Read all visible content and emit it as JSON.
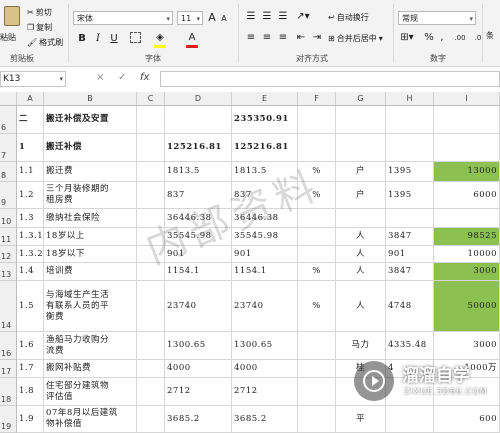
{
  "ribbon": {
    "clipboard": {
      "paste": "粘贴",
      "cut": "剪切",
      "copy": "复制",
      "format_painter": "格式刷",
      "group": "剪贴板"
    },
    "font": {
      "name": "宋体",
      "size": "11",
      "grow": "A",
      "shrink": "A",
      "bold": "B",
      "italic": "I",
      "underline": "U",
      "group": "字体"
    },
    "alignment": {
      "wrap": "自动换行",
      "merge": "合并后居中",
      "group": "对齐方式"
    },
    "number": {
      "format": "常规",
      "percent": "%",
      "comma": ",",
      "group": "数字",
      "extra": "条"
    }
  },
  "formula_bar": {
    "name_box": "K13",
    "cancel": "×",
    "enter": "✓",
    "fx": "fx",
    "value": ""
  },
  "columns": [
    "A",
    "B",
    "C",
    "D",
    "E",
    "F",
    "G",
    "H",
    "I"
  ],
  "rows": [
    {
      "n": "6",
      "a": "二",
      "b": "搬迁补偿及安置",
      "c": "",
      "d": "",
      "e": "235350.91",
      "f": "",
      "g": "",
      "h": "",
      "i": ""
    },
    {
      "n": "7",
      "a": "1",
      "b": "搬迁补偿",
      "c": "",
      "d": "125216.81",
      "e": "125216.81",
      "f": "",
      "g": "",
      "h": "",
      "i": ""
    },
    {
      "n": "8",
      "a": "1.1",
      "b": "搬迁费",
      "c": "",
      "d": "1813.5",
      "e": "1813.5",
      "f": "%",
      "g": "户",
      "h": "1395",
      "i": "13000"
    },
    {
      "n": "9",
      "a": "1.2",
      "b": "三个月装修期的\n租房费",
      "c": "",
      "d": "837",
      "e": "837",
      "f": "%",
      "g": "户",
      "h": "1395",
      "i": "6000"
    },
    {
      "n": "10",
      "a": "1.3",
      "b": "缴纳社会保险",
      "c": "",
      "d": "36446.38",
      "e": "36446.38",
      "f": "",
      "g": "",
      "h": "",
      "i": ""
    },
    {
      "n": "11",
      "a": "1.3.1",
      "b": "18岁以上",
      "c": "",
      "d": "35545.98",
      "e": "35545.98",
      "f": "",
      "g": "人",
      "h": "3847",
      "i": "98525"
    },
    {
      "n": "12",
      "a": "1.3.2",
      "b": "18岁以下",
      "c": "",
      "d": "901",
      "e": "901",
      "f": "",
      "g": "人",
      "h": "901",
      "i": "10000"
    },
    {
      "n": "13",
      "a": "1.4",
      "b": "培训费",
      "c": "",
      "d": "1154.1",
      "e": "1154.1",
      "f": "%",
      "g": "人",
      "h": "3847",
      "i": "3000"
    },
    {
      "n": "14",
      "a": "1.5",
      "b": "与海域生产生活\n有联系人员的平\n衡费",
      "c": "",
      "d": "23740",
      "e": "23740",
      "f": "%",
      "g": "人",
      "h": "4748",
      "i": "50000"
    },
    {
      "n": "16",
      "a": "1.6",
      "b": "渔船马力收购分\n流费",
      "c": "",
      "d": "1300.65",
      "e": "1300.65",
      "f": "",
      "g": "马力",
      "h": "4335.48",
      "i": "3000"
    },
    {
      "n": "17",
      "a": "1.7",
      "b": "搬网补贴费",
      "c": "",
      "d": "4000",
      "e": "4000",
      "f": "",
      "g": "桂",
      "h": "4",
      "i": "1000万"
    },
    {
      "n": "18",
      "a": "1.8",
      "b": "住宅部分建筑物\n评估值",
      "c": "",
      "d": "2712",
      "e": "2712",
      "f": "",
      "g": "",
      "h": "",
      "i": ""
    },
    {
      "n": "19",
      "a": "1.9",
      "b": "07年8月以后建筑\n物补偿值",
      "c": "",
      "d": "3685.2",
      "e": "3685.2",
      "f": "",
      "g": "平",
      "h": "",
      "i": "600"
    }
  ],
  "highlight_color": "#8cc152",
  "watermark": "内部资料",
  "logo": {
    "title": "溜溜自学",
    "subtitle": "ZIXUE.3D66.COM"
  }
}
